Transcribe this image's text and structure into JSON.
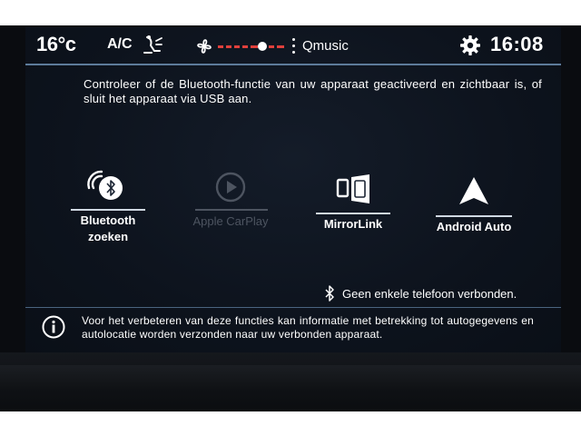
{
  "status_bar": {
    "temperature": "16°c",
    "ac_label": "A/C",
    "radio_station": "Qmusic",
    "time": "16:08",
    "fan_level": 0.6
  },
  "main": {
    "instruction": "Controleer of de Bluetooth-functie van uw apparaat geactiveerd en zichtbaar is, of sluit het apparaat via USB aan.",
    "apps": [
      {
        "label_line1": "Bluetooth",
        "label_line2": "zoeken",
        "icon": "bluetooth-search-icon",
        "enabled": true
      },
      {
        "label_line1": "Apple CarPlay",
        "label_line2": "",
        "icon": "apple-carplay-icon",
        "enabled": false
      },
      {
        "label_line1": "MirrorLink",
        "label_line2": "",
        "icon": "mirrorlink-icon",
        "enabled": true
      },
      {
        "label_line1": "Android Auto",
        "label_line2": "",
        "icon": "android-auto-icon",
        "enabled": true
      }
    ],
    "connection_status": "Geen enkele telefoon verbonden."
  },
  "footer": {
    "info_text": "Voor het verbeteren van deze functies kan informatie met betrekking tot autogegevens en autolocatie worden verzonden naar uw verbonden apparaat."
  },
  "colors": {
    "background": "#0d131d",
    "accent_line": "#5d7b9a",
    "fan_red": "#e0403c",
    "text": "#ffffff",
    "disabled": "#4d5460"
  }
}
